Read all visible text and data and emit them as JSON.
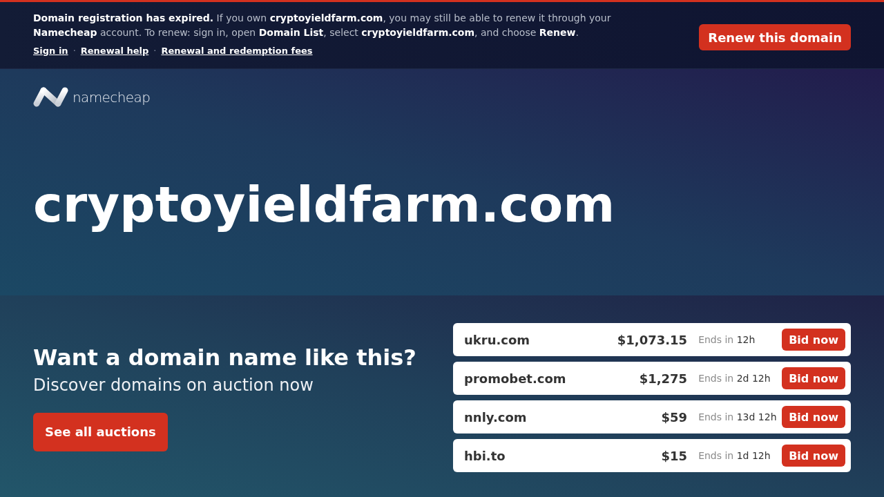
{
  "banner": {
    "message": "**Domain registration has expired.** If you own **cryptoyieldfarm.com**, you may still be able to renew it through your **Namecheap** account. To renew: sign in, open **Domain List**, select **cryptoyieldfarm.com**, and choose **Renew**.",
    "links": [
      "Sign in",
      "Renewal help",
      "Renewal and redemption fees"
    ],
    "link_separator": "·",
    "button": "Renew this domain"
  },
  "logo": {
    "wordmark": "namecheap"
  },
  "hero": {
    "domain": "cryptoyieldfarm.com"
  },
  "auctions": {
    "heading": "Want a domain name like this?",
    "subheading": "Discover domains on auction now",
    "button": "See all auctions",
    "listings": [
      {
        "domain": "ukru.com",
        "price": "$1,073.15",
        "ends_label": "Ends in",
        "ends_time": "12h",
        "button": "Bid now"
      },
      {
        "domain": "promobet.com",
        "price": "$1,275",
        "ends_label": "Ends in",
        "ends_time": "2d 12h",
        "button": "Bid now"
      },
      {
        "domain": "nnly.com",
        "price": "$59",
        "ends_label": "Ends in",
        "ends_time": "13d 12h",
        "button": "Bid now"
      },
      {
        "domain": "hbi.to",
        "price": "$15",
        "ends_label": "Ends in",
        "ends_time": "1d 12h",
        "button": "Bid now"
      }
    ]
  }
}
